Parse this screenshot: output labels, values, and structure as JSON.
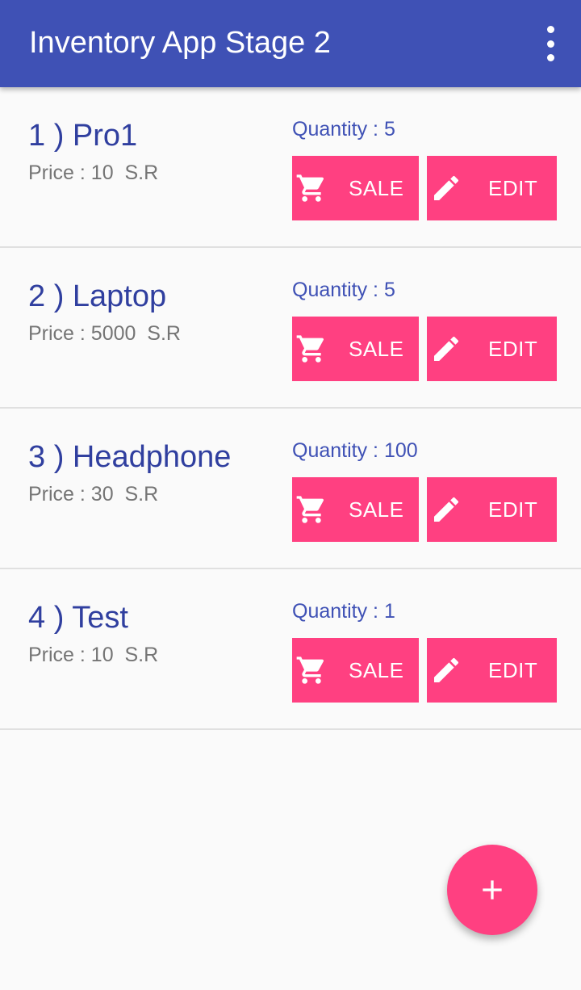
{
  "app": {
    "title": "Inventory App Stage 2",
    "accent_color": "#ff4081",
    "primary_color": "#3f51b5",
    "more_icon": "more-vert-icon"
  },
  "products": [
    {
      "name": "1 ) Pro1",
      "price": "Price : 10  S.R",
      "quantity": "Quantity : 5",
      "sale_label": "SALE",
      "edit_label": "EDIT"
    },
    {
      "name": "2 ) Laptop",
      "price": "Price : 5000  S.R",
      "quantity": "Quantity : 5",
      "sale_label": "SALE",
      "edit_label": "EDIT"
    },
    {
      "name": "3 ) Headphone",
      "price": "Price : 30  S.R",
      "quantity": "Quantity : 100",
      "sale_label": "SALE",
      "edit_label": "EDIT"
    },
    {
      "name": "4 ) Test",
      "price": "Price : 10  S.R",
      "quantity": "Quantity : 1",
      "sale_label": "SALE",
      "edit_label": "EDIT"
    }
  ],
  "fab": {
    "icon": "add-icon"
  }
}
